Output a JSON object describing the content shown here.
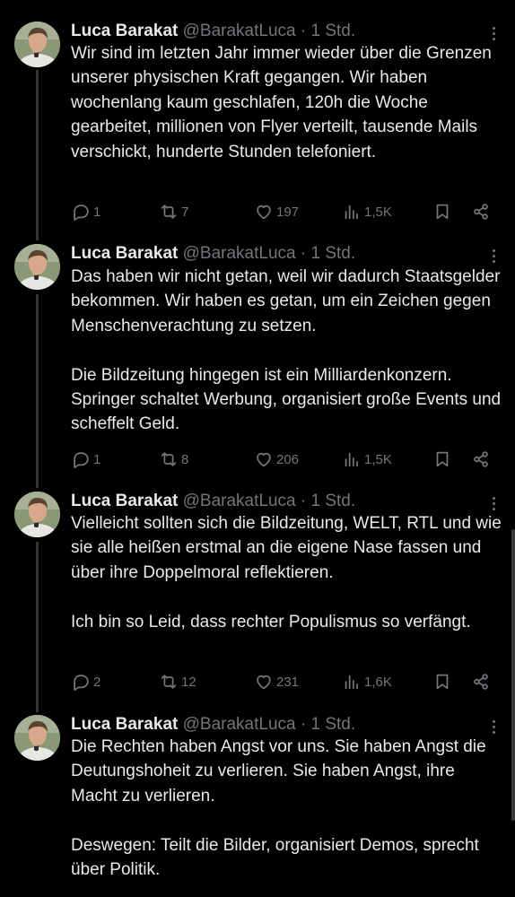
{
  "tweets": [
    {
      "author": "Luca Barakat",
      "handle": "@BarakatLuca",
      "dot": "·",
      "time": "1 Std.",
      "paragraphs": [
        "Wir sind im letzten Jahr immer wieder über die Grenzen unserer physischen Kraft gegangen. Wir haben wochenlang kaum geschlafen, 120h die Woche gearbeitet, millionen von Flyer verteilt, tausende Mails verschickt, hunderte Stunden telefoniert."
      ],
      "replies": "1",
      "reposts": "7",
      "likes": "197",
      "views": "1,5K"
    },
    {
      "author": "Luca Barakat",
      "handle": "@BarakatLuca",
      "dot": "·",
      "time": "1 Std.",
      "paragraphs": [
        "Das haben wir nicht getan, weil wir dadurch Staatsgelder bekommen. Wir haben es getan, um ein Zeichen gegen Menschenverachtung zu setzen.",
        "Die Bildzeitung hingegen ist ein Milliardenkonzern. Springer schaltet Werbung, organisiert große Events und scheffelt Geld."
      ],
      "replies": "1",
      "reposts": "8",
      "likes": "206",
      "views": "1,5K"
    },
    {
      "author": "Luca Barakat",
      "handle": "@BarakatLuca",
      "dot": "·",
      "time": "1 Std.",
      "paragraphs": [
        "Vielleicht sollten sich die Bildzeitung, WELT, RTL und wie sie alle heißen erstmal an die eigene Nase fassen und über ihre Doppelmoral reflektieren.",
        "Ich bin so Leid, dass rechter Populismus so verfängt."
      ],
      "replies": "2",
      "reposts": "12",
      "likes": "231",
      "views": "1,6K"
    },
    {
      "author": "Luca Barakat",
      "handle": "@BarakatLuca",
      "dot": "·",
      "time": "1 Std.",
      "paragraphs": [
        "Die Rechten haben Angst vor uns. Sie haben Angst die Deutungshoheit zu verlieren. Sie haben Angst, ihre Macht zu verlieren.",
        "Deswegen: Teilt die Bilder, organisiert Demos, sprecht über Politik."
      ]
    }
  ],
  "icons": {
    "reply": "reply-icon",
    "repost": "repost-icon",
    "like": "heart-icon",
    "views": "views-icon",
    "bookmark": "bookmark-icon",
    "share": "share-icon",
    "more": "more-options-icon"
  },
  "colors": {
    "background": "#000000",
    "text": "#e7e9ea",
    "secondary": "#71767b",
    "thread_line": "#333639"
  }
}
